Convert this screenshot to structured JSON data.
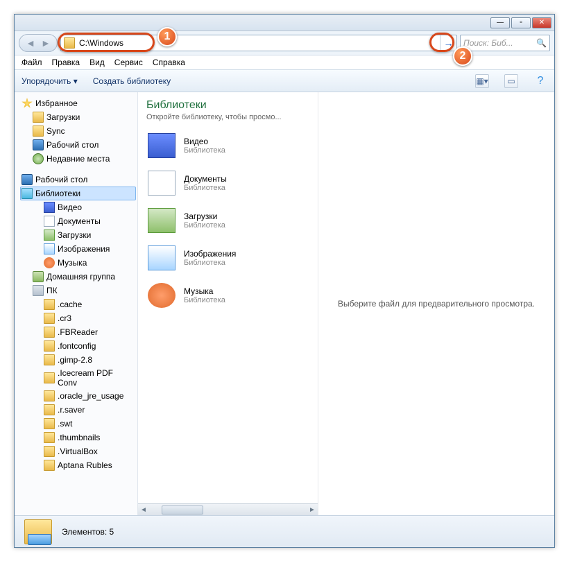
{
  "address_path": "C:\\Windows",
  "search_placeholder": "Поиск: Биб...",
  "menu": [
    "Файл",
    "Правка",
    "Вид",
    "Сервис",
    "Справка"
  ],
  "toolbar": {
    "organize": "Упорядочить ▾",
    "create_lib": "Создать библиотеку"
  },
  "tree": {
    "favorites": "Избранное",
    "favorites_items": [
      "Загрузки",
      "Sync",
      "Рабочий стол",
      "Недавние места"
    ],
    "desktop": "Рабочий стол",
    "libraries": "Библиотеки",
    "library_items": [
      "Видео",
      "Документы",
      "Загрузки",
      "Изображения",
      "Музыка"
    ],
    "homegroup": "Домашняя группа",
    "pc": "ПК",
    "pc_folders": [
      ".cache",
      ".cr3",
      ".FBReader",
      ".fontconfig",
      ".gimp-2.8",
      ".Icecream PDF Conv",
      ".oracle_jre_usage",
      ".r.saver",
      ".swt",
      ".thumbnails",
      ".VirtualBox",
      "Aptana Rubles"
    ]
  },
  "content": {
    "heading": "Библиотеки",
    "subheading": "Откройте библиотеку, чтобы просмо...",
    "items": [
      {
        "name": "Видео",
        "type": "Библиотека",
        "icon": "video"
      },
      {
        "name": "Документы",
        "type": "Библиотека",
        "icon": "doc"
      },
      {
        "name": "Загрузки",
        "type": "Библиотека",
        "icon": "dl"
      },
      {
        "name": "Изображения",
        "type": "Библиотека",
        "icon": "img"
      },
      {
        "name": "Музыка",
        "type": "Библиотека",
        "icon": "music"
      }
    ]
  },
  "preview_empty": "Выберите файл для предварительного просмотра.",
  "status": {
    "label": "Элементов: 5"
  },
  "callouts": {
    "one": "1",
    "two": "2"
  }
}
